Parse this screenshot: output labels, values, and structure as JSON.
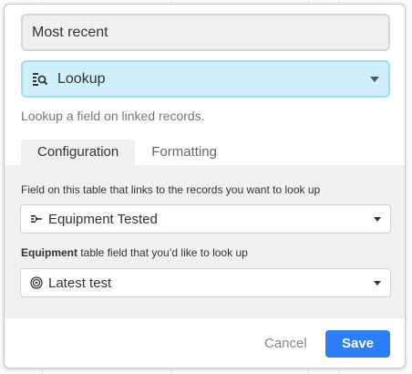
{
  "dialog": {
    "field_name": "Most recent",
    "field_type": {
      "label": "Lookup",
      "icon": "lookup-icon"
    },
    "description": "Lookup a field on linked records.",
    "tabs": [
      {
        "label": "Configuration",
        "active": true
      },
      {
        "label": "Formatting",
        "active": false
      }
    ],
    "config": {
      "link_field_label": "Field on this table that links to the records you want to look up",
      "link_field_value": "Equipment Tested",
      "link_field_icon": "linked-record-icon",
      "lookup_field_label_bold": "Equipment",
      "lookup_field_label_rest": " table field that you’d like to look up",
      "lookup_field_value": "Latest test",
      "lookup_field_icon": "rollup-spiral-icon"
    },
    "footer": {
      "cancel_label": "Cancel",
      "save_label": "Save"
    }
  },
  "colors": {
    "accent": "#2d7ff9",
    "type_select_bg": "#cfeffa",
    "panel_bg": "#f0f0f0"
  }
}
